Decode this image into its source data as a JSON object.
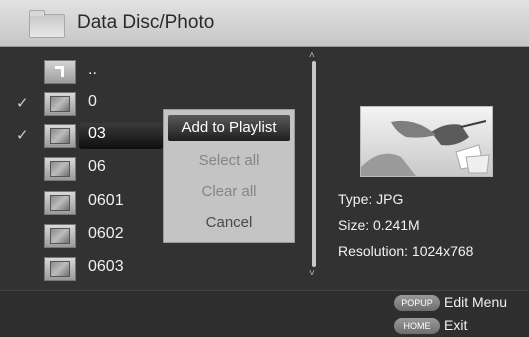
{
  "header": {
    "title": "Data Disc/Photo",
    "icon": "folder-icon"
  },
  "files": [
    {
      "name": "..",
      "checked": false,
      "kind": "parent"
    },
    {
      "name": "0",
      "checked": true,
      "kind": "photo"
    },
    {
      "name": "03",
      "checked": true,
      "kind": "photo",
      "selected": true
    },
    {
      "name": "06",
      "checked": false,
      "kind": "photo"
    },
    {
      "name": "0601",
      "checked": false,
      "kind": "photo"
    },
    {
      "name": "0602",
      "checked": false,
      "kind": "photo"
    },
    {
      "name": "0603",
      "checked": false,
      "kind": "photo"
    }
  ],
  "context_menu": {
    "items": [
      {
        "label": "Add to Playlist",
        "state": "active"
      },
      {
        "label": "Select all",
        "state": "disabled"
      },
      {
        "label": "Clear all",
        "state": "disabled"
      },
      {
        "label": "Cancel",
        "state": "normal"
      }
    ]
  },
  "file_info": {
    "type": "Type: JPG",
    "size": "Size: 0.241M",
    "resolution": "Resolution: 1024x768"
  },
  "scroll": {
    "up_glyph": "˄",
    "down_glyph": "˅"
  },
  "footer": {
    "popup": {
      "key": "POPUP",
      "label": "Edit Menu"
    },
    "home": {
      "key": "HOME",
      "label": "Exit"
    }
  },
  "check_glyph": "✓"
}
